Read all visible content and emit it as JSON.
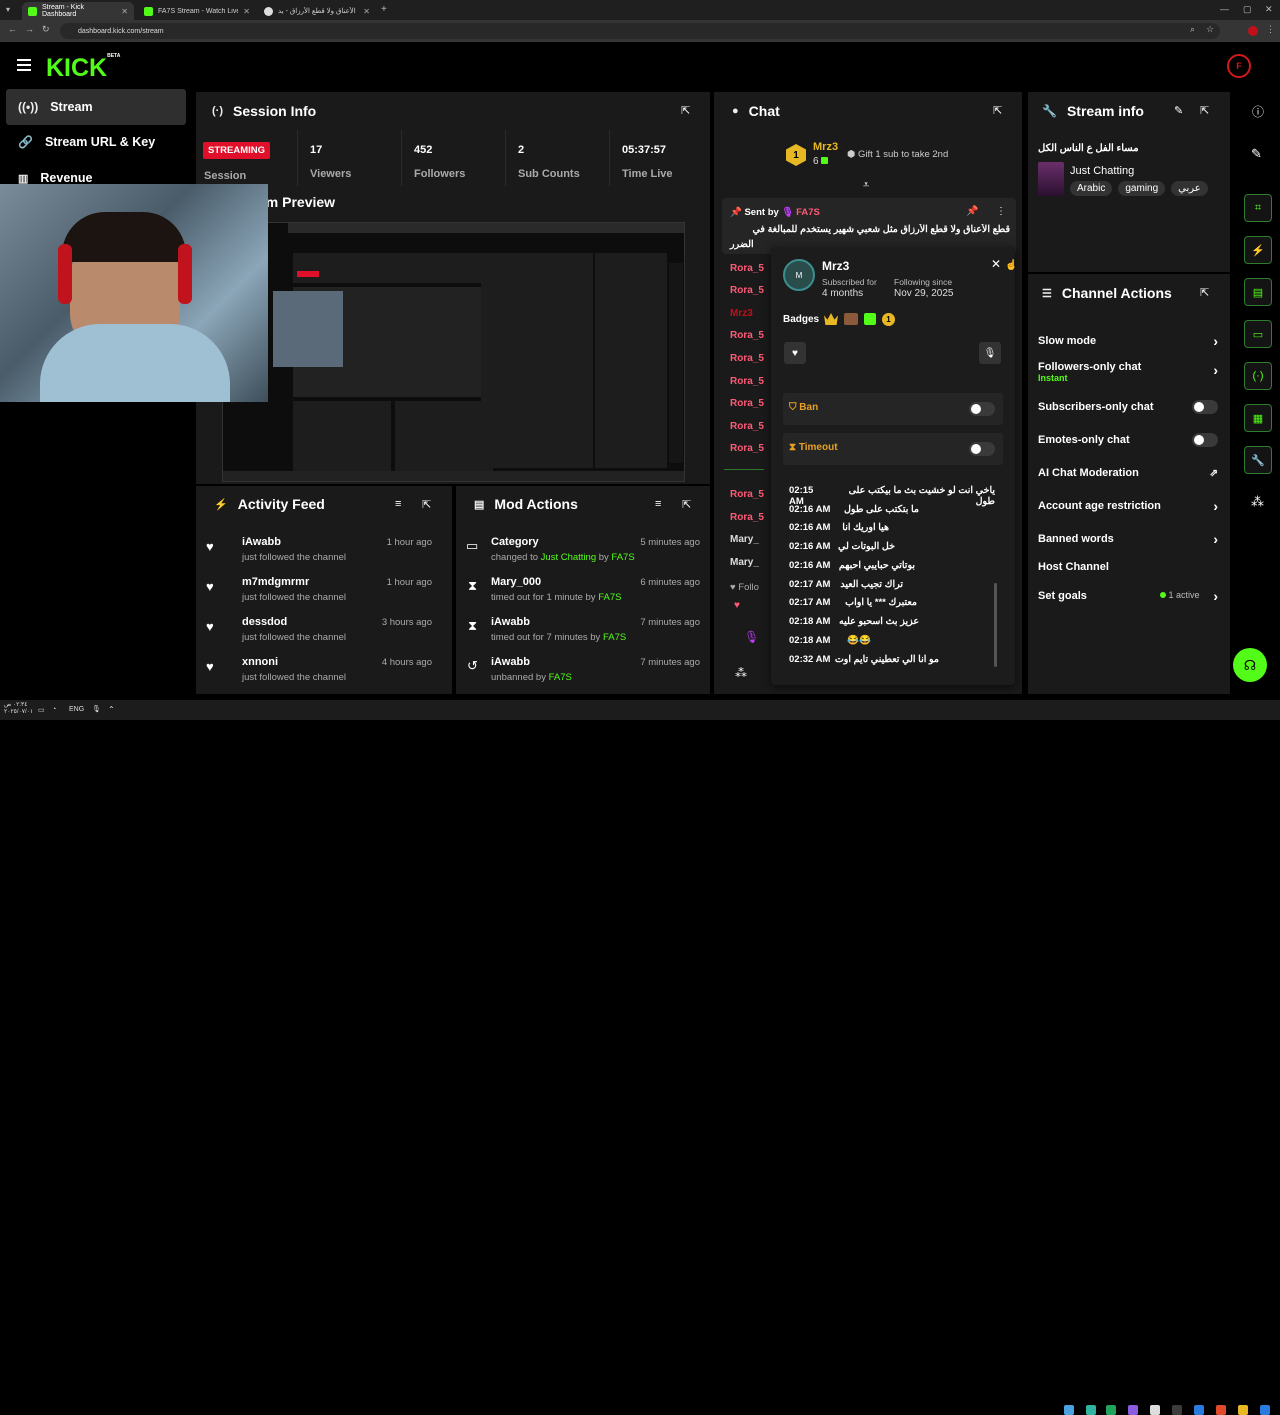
{
  "browser": {
    "tabs": [
      {
        "title": "Stream - Kick Dashboard",
        "active": true
      },
      {
        "title": "FA7S Stream - Watch Live on Ki",
        "active": false
      },
      {
        "title": "قطع الأعناق ولا قطع الأرزاق - يد...",
        "active": false
      }
    ],
    "url": "dashboard.kick.com/stream"
  },
  "header": {
    "logo": "KICK",
    "logo_sup": "BETA"
  },
  "sidebar": {
    "items": [
      {
        "label": "Stream",
        "icon": "broadcast-icon",
        "active": true
      },
      {
        "label": "Stream URL & Key",
        "icon": "link-icon",
        "active": false
      },
      {
        "label": "Revenue",
        "icon": "chart-icon",
        "active": false
      }
    ]
  },
  "session": {
    "title": "Session Info",
    "badge": "STREAMING",
    "badge_sub": "Session",
    "stats": [
      {
        "value": "17",
        "label": "Viewers"
      },
      {
        "value": "452",
        "label": "Followers"
      },
      {
        "value": "2",
        "label": "Sub Counts"
      },
      {
        "value": "05:37:57",
        "label": "Time Live"
      }
    ]
  },
  "preview": {
    "title": "Stream Preview",
    "title_visible": "am Preview"
  },
  "activity": {
    "title": "Activity Feed",
    "items": [
      {
        "name": "iAwabb",
        "sub": "just followed the channel",
        "time": "1 hour ago"
      },
      {
        "name": "m7mdgmrmr",
        "sub": "just followed the channel",
        "time": "1 hour ago"
      },
      {
        "name": "dessdod",
        "sub": "just followed the channel",
        "time": "3 hours ago"
      },
      {
        "name": "xnnoni",
        "sub": "just followed the channel",
        "time": "4 hours ago"
      }
    ]
  },
  "mod": {
    "title": "Mod Actions",
    "items": [
      {
        "name": "Category",
        "pre": "changed to ",
        "hl": "Just Chatting",
        "by": " by ",
        "actor": "FA7S",
        "time": "5 minutes ago"
      },
      {
        "name": "Mary_000",
        "pre": "timed out for 1 minute by ",
        "hl": "",
        "by": "",
        "actor": "FA7S",
        "time": "6 minutes ago"
      },
      {
        "name": "iAwabb",
        "pre": "timed out for 7 minutes by ",
        "hl": "",
        "by": "",
        "actor": "FA7S",
        "time": "7 minutes ago"
      },
      {
        "name": "iAwabb",
        "pre": "unbanned by ",
        "hl": "",
        "by": "",
        "actor": "FA7S",
        "time": "7 minutes ago"
      }
    ]
  },
  "chat": {
    "title": "Chat",
    "gifter": "Mrz3",
    "gifter_count": "6",
    "gift_prompt": "Gift 1 sub to take 2nd",
    "pinned_by_label": "Sent by",
    "pinned_by": "FA7S",
    "pinned_text": "قطع الأعناق ولا قطع الأرزاق مثل شعبي شهير يستخدم للمبالغة في",
    "pinned_text2": "الضرر",
    "chat_names": [
      "Rora_5",
      "Rora_5",
      "Mrz3",
      "Rora_5",
      "Rora_5",
      "Rora_5",
      "Rora_5",
      "Rora_5",
      "Rora_5",
      "Rora_5",
      "Mary_",
      "Mary_"
    ],
    "follow_label": "Follo"
  },
  "usercard": {
    "name": "Mrz3",
    "subscribed_label": "Subscribed for",
    "subscribed_val": "4 months",
    "following_label": "Following since",
    "following_val": "Nov 29, 2025",
    "badges_label": "Badges",
    "ban_label": "Ban",
    "timeout_label": "Timeout",
    "messages": [
      {
        "time": "02:15 AM",
        "text": "ياخي انت لو خشيت بث ما بيكتب على طول"
      },
      {
        "time": "02:16 AM",
        "text": "ما بتكتب على طول"
      },
      {
        "time": "02:16 AM",
        "text": "هيا اوريك انا"
      },
      {
        "time": "02:16 AM",
        "text": "خل البوتات لي"
      },
      {
        "time": "02:16 AM",
        "text": "بوتاتي حبايبي احبهم"
      },
      {
        "time": "02:17 AM",
        "text": "تراك تجيب العيد"
      },
      {
        "time": "02:17 AM",
        "text": "معتبرك *** يا اواب"
      },
      {
        "time": "02:18 AM",
        "text": "عزيز بث اسحبو عليه"
      },
      {
        "time": "02:18 AM",
        "text": "😂😂"
      },
      {
        "time": "02:32 AM",
        "text": "مو انا الي تعطيني تايم اوت"
      }
    ]
  },
  "stream_info": {
    "title": "Stream info",
    "stream_title": "مساء الفل ع الناس الكل",
    "category": "Just Chatting",
    "tags": [
      "Arabic",
      "gaming",
      "عربي"
    ]
  },
  "channel_actions": {
    "title": "Channel Actions",
    "items": [
      {
        "label": "Slow mode",
        "sub": "",
        "control": "chevron"
      },
      {
        "label": "Followers-only chat",
        "sub": "Instant",
        "control": "chevron"
      },
      {
        "label": "Subscribers-only chat",
        "sub": "",
        "control": "toggle"
      },
      {
        "label": "Emotes-only chat",
        "sub": "",
        "control": "toggle"
      },
      {
        "label": "AI Chat Moderation",
        "sub": "",
        "control": "external"
      },
      {
        "label": "Account age restriction",
        "sub": "",
        "control": "chevron"
      },
      {
        "label": "Banned words",
        "sub": "",
        "control": "chevron"
      },
      {
        "label": "Host Channel",
        "sub": "",
        "control": "none"
      },
      {
        "label": "Set goals",
        "sub": "",
        "control": "chevron",
        "status": "1 active"
      }
    ]
  },
  "taskbar": {
    "lang": "ENG",
    "time": "٠٢:٣٤ ص",
    "date": "٢٠٢٥/٠٧/٠١"
  },
  "colors": {
    "accent": "#53fc18",
    "live": "#e0102a",
    "chat_name": "#ff5a78",
    "panel": "#1a1a1a"
  }
}
